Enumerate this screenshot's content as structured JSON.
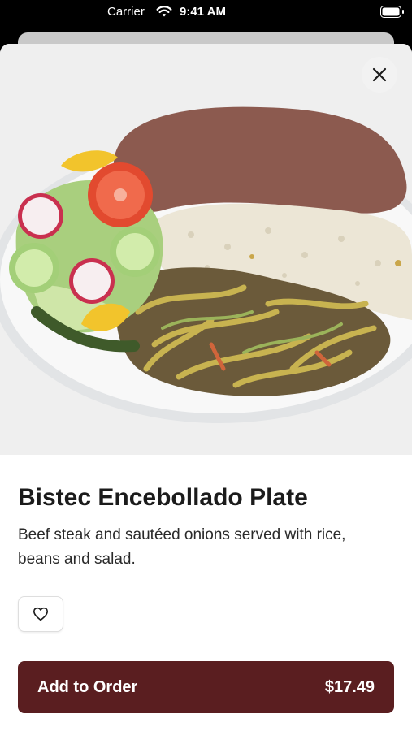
{
  "status_bar": {
    "carrier": "Carrier",
    "time": "9:41 AM",
    "wifi_icon": "wifi-icon",
    "battery_icon": "battery-icon"
  },
  "item": {
    "image_icon": "dish-photo",
    "title": "Bistec Encebollado Plate",
    "description": "Beef steak and sautéed onions served with rice, beans and salad."
  },
  "actions": {
    "close_icon": "close-icon",
    "favorite_icon": "heart-icon",
    "add_to_order_label": "Add to Order",
    "price": "$17.49"
  },
  "colors": {
    "primary_button": "#5a1e20",
    "text": "#1b1b1b"
  }
}
